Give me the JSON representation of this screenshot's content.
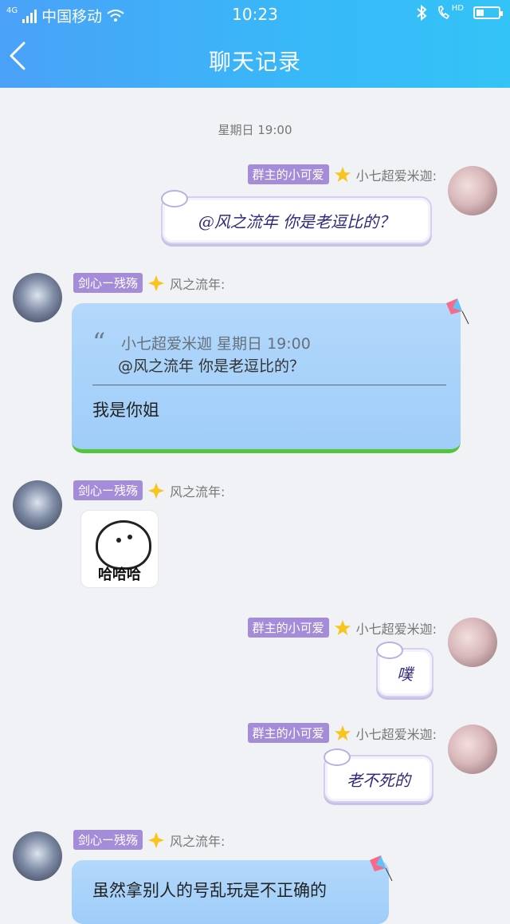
{
  "status_bar": {
    "network": "4G",
    "carrier": "中国移动",
    "time": "10:23",
    "hd": "HD",
    "battery_level": 0.35
  },
  "nav": {
    "title": "聊天记录"
  },
  "timestamp": "星期日 19:00",
  "messages": [
    {
      "badge": "群主的小可爱",
      "sender": "小七超爱米迦:",
      "text": "@风之流年 你是老逗比的？"
    },
    {
      "badge": "剑心ー残殇",
      "sender": "风之流年:",
      "quote": {
        "author": "小七超爱米迦 星期日 19:00",
        "text": "@风之流年 你是老逗比的？"
      },
      "text": "我是你姐"
    },
    {
      "badge": "剑心ー残殇",
      "sender": "风之流年:",
      "sticker_text": "哈哈哈"
    },
    {
      "badge": "群主的小可爱",
      "sender": "小七超爱米迦:",
      "text": "噗"
    },
    {
      "badge": "群主的小可爱",
      "sender": "小七超爱米迦:",
      "text": "老不死的"
    },
    {
      "badge": "剑心ー残殇",
      "sender": "风之流年:",
      "text": "虽然拿别人的号乱玩是不正确的"
    }
  ]
}
